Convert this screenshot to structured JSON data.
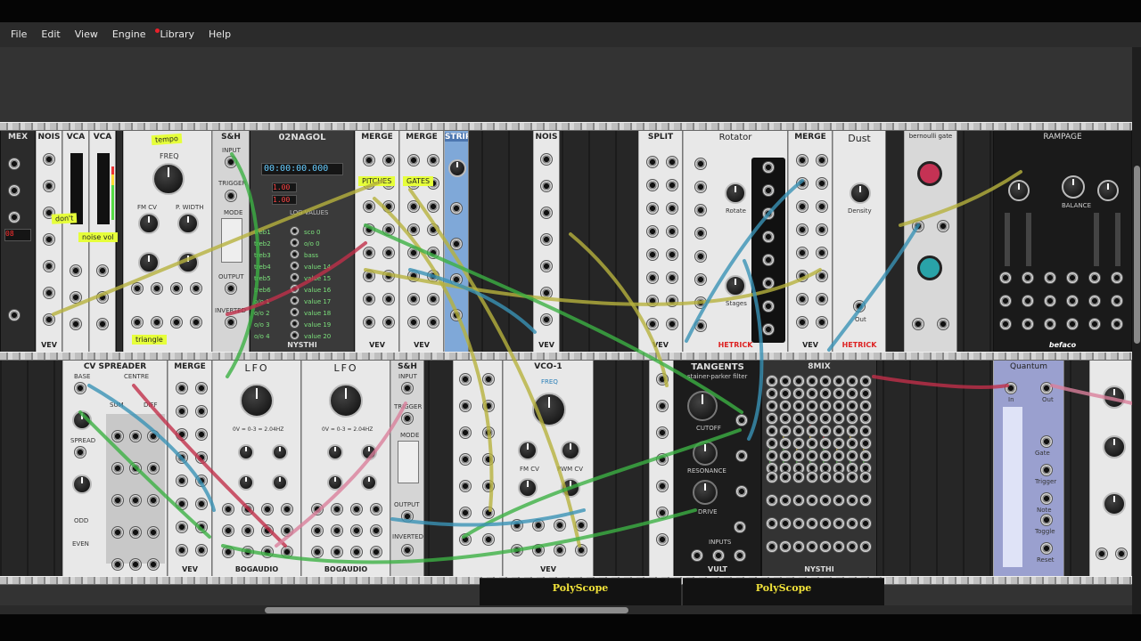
{
  "menu": {
    "items": [
      "File",
      "Edit",
      "View",
      "Engine",
      "Library",
      "Help"
    ],
    "library_notification": true
  },
  "modules_top": {
    "mex": "MEX",
    "nois1": "NOIS",
    "vca1": "VCA",
    "vca2": "VCA",
    "sh1": "S&H",
    "nagol": "02NAGOL",
    "merge1": "MERGE",
    "merge2": "MERGE",
    "strip": "STRIP",
    "nois2": "NOIS",
    "split": "SPLIT",
    "rotator": "Rotator",
    "merge3": "MERGE",
    "dust": "Dust",
    "bernoulli": "bernoulli gate",
    "rampage": "RAMPAGE"
  },
  "modules_bottom": {
    "cvspreader": "CV SPREADER",
    "merge4": "MERGE",
    "lfo1": "LFO",
    "lfo2": "LFO",
    "sh2": "S&H",
    "vco1": "VCO-1",
    "tangents": "TANGENTS",
    "tangents_sub": "stainer-parker filter",
    "mix": "8MIX",
    "quantum": "Quantum"
  },
  "brands": {
    "vev": "VEV",
    "bogaudio": "BOGAUDIO",
    "hetrick": "HETRICK",
    "nysthi": "NYSTHI",
    "vult": "VULT",
    "befaco": "befaco"
  },
  "nagol_display": {
    "time": "00:00:00.000",
    "v1": "1.00",
    "v2": "1.00"
  },
  "nagol_labels": [
    "treb1",
    "treb2",
    "treb3",
    "treb4",
    "treb5",
    "treb6",
    "o/o 1",
    "o/o 2",
    "o/o 3",
    "o/o 4"
  ],
  "nagol_values": [
    "sco 0",
    "o/o 0",
    "bass",
    "value 14",
    "value 15",
    "value 16",
    "value 17",
    "value 18",
    "value 19",
    "value 20"
  ],
  "notes": {
    "tempo": "tempo",
    "dont": "don't",
    "noise_vol": "noise vol",
    "triangle": "triangle",
    "pitches": "PITCHES",
    "gates": "GATES"
  },
  "labels": {
    "freq": "FREQ",
    "pw": "P. WIDTH",
    "fmcv": "FM CV",
    "pwmcv": "PWM CV",
    "input": "INPUT",
    "trigger": "TRIGGER",
    "output": "OUTPUT",
    "inverted": "INVERTED",
    "mode": "MODE",
    "rotate": "Rotate",
    "stages": "Stages",
    "density": "Density",
    "out": "Out",
    "in": "In",
    "base": "BASE",
    "spread": "SPREAD",
    "sum": "SUM",
    "centre": "CENTRE",
    "diff": "DIFF",
    "odd": "ODD",
    "even": "EVEN",
    "cutoff": "CUTOFF",
    "resonance": "RESONANCE",
    "drive": "DRIVE",
    "inputs": "INPUTS",
    "rise": "RISE",
    "fall": "FALL",
    "balance": "BALANCE",
    "range": "RANGE",
    "trigs": "TRIGG",
    "gate": "Gate",
    "trigger_q": "Trigger",
    "note": "Note",
    "toggle": "Toggle",
    "reset": "Reset",
    "lfo_range": "0V = 0-3 = 2.04HZ",
    "scale": "LOG VALUES"
  },
  "polyscope": [
    "PolyScope",
    "PolyScope"
  ],
  "colors": {
    "cable_yellow": "#b7b23d",
    "cable_green": "#3cb043",
    "cable_blue": "#3a92b5",
    "cable_red": "#c0304a",
    "cable_pink": "#d9809b"
  }
}
